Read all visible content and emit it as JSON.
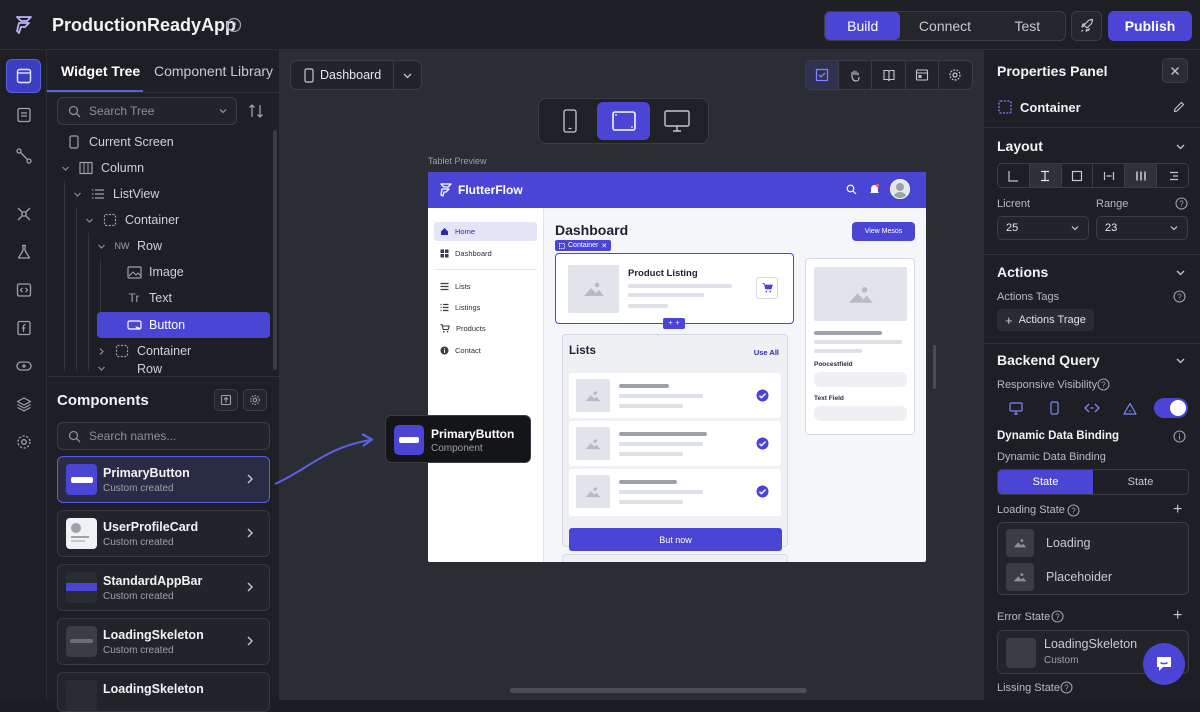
{
  "app": {
    "title": "ProductionReadyApp"
  },
  "header": {
    "modes": [
      "Build",
      "Connect",
      "Test"
    ],
    "active_mode": "Build",
    "publish_label": "Publish"
  },
  "rail": {
    "icons": [
      "pages-icon",
      "storyboard-icon",
      "connect-icon",
      "integrations-icon",
      "flask-icon",
      "code-icon",
      "firebase-icon",
      "custom-code-icon",
      "layers-icon",
      "settings-icon"
    ],
    "active": "pages-icon"
  },
  "left_panel": {
    "tabs": [
      "Widget Tree",
      "Component Library"
    ],
    "tree_search_placeholder": "Search Tree",
    "tree": [
      {
        "label": "Current Screen",
        "icon": "phone-icon"
      },
      {
        "label": "Column",
        "icon": "column-icon"
      },
      {
        "label": "ListView",
        "icon": "list-icon"
      },
      {
        "label": "Container",
        "icon": "container-icon"
      },
      {
        "label": "Row",
        "icon": "row-icon",
        "prefix": "NW"
      },
      {
        "label": "Image",
        "icon": "image-icon"
      },
      {
        "label": "Text",
        "icon": "text-icon",
        "prefix": "Tr"
      },
      {
        "label": "Button",
        "icon": "button-icon",
        "selected": true
      },
      {
        "label": "Container",
        "icon": "container-icon"
      },
      {
        "label": "Row",
        "icon": "row-icon"
      }
    ],
    "components_title": "Components",
    "components_search_placeholder": "Search names...",
    "components": [
      {
        "name": "PrimaryButton",
        "sub": "Custom created",
        "selected": true
      },
      {
        "name": "UserProfileCard",
        "sub": "Custom created"
      },
      {
        "name": "StandardAppBar",
        "sub": "Custom created"
      },
      {
        "name": "LoadingSkeleton",
        "sub": "Custom created"
      },
      {
        "name": "LoadingSkeleton",
        "sub": ""
      }
    ]
  },
  "canvas": {
    "page_name": "Dashboard",
    "preview_label": "Tablet Preview",
    "devices": [
      "phone-icon",
      "tablet-icon",
      "desktop-icon"
    ],
    "active_device": "tablet-icon",
    "popup": {
      "name": "PrimaryButton",
      "sub": "Component"
    },
    "preview": {
      "brand": "FlutterFlow",
      "nav": [
        "Home",
        "Dashboard",
        "Lists",
        "Listings",
        "Products",
        "Contact"
      ],
      "active_nav": "Home",
      "title": "Dashboard",
      "view_button": "View Mesos",
      "container_tag": "Container",
      "product_title": "Product Listing",
      "lists_title": "Lists",
      "see_all": "Use All",
      "buy_button": "But now",
      "right_labels": [
        "Poocestfield",
        "Text Field"
      ]
    }
  },
  "right_panel": {
    "title": "Properties Panel",
    "selected_widget": "Container",
    "layout": {
      "title": "Layout",
      "field1_label": "Licrent",
      "field1_value": "25",
      "field2_label": "Range",
      "field2_value": "23"
    },
    "actions": {
      "title": "Actions",
      "tags_label": "Actions Tags",
      "tag_button": "Actions Trage"
    },
    "backend": {
      "title": "Backend Query",
      "responsive_label": "Responsive Visibility",
      "responsive_visible": true,
      "binding_title": "Dynamic Data Binding",
      "binding_sub": "Dynamic Data Binding",
      "state_tabs": [
        "State",
        "State"
      ],
      "loading_label": "Loading State",
      "loading_items": [
        "Loading",
        "Placehoider"
      ],
      "error_label": "Error State",
      "error_item": "LoadingSkeleton",
      "error_item_sub": "Custom",
      "last_label": "Lissing State"
    }
  },
  "colors": {
    "accent": "#4b45d6",
    "bg": "#1d1f24",
    "canvas": "#2a2d33"
  }
}
